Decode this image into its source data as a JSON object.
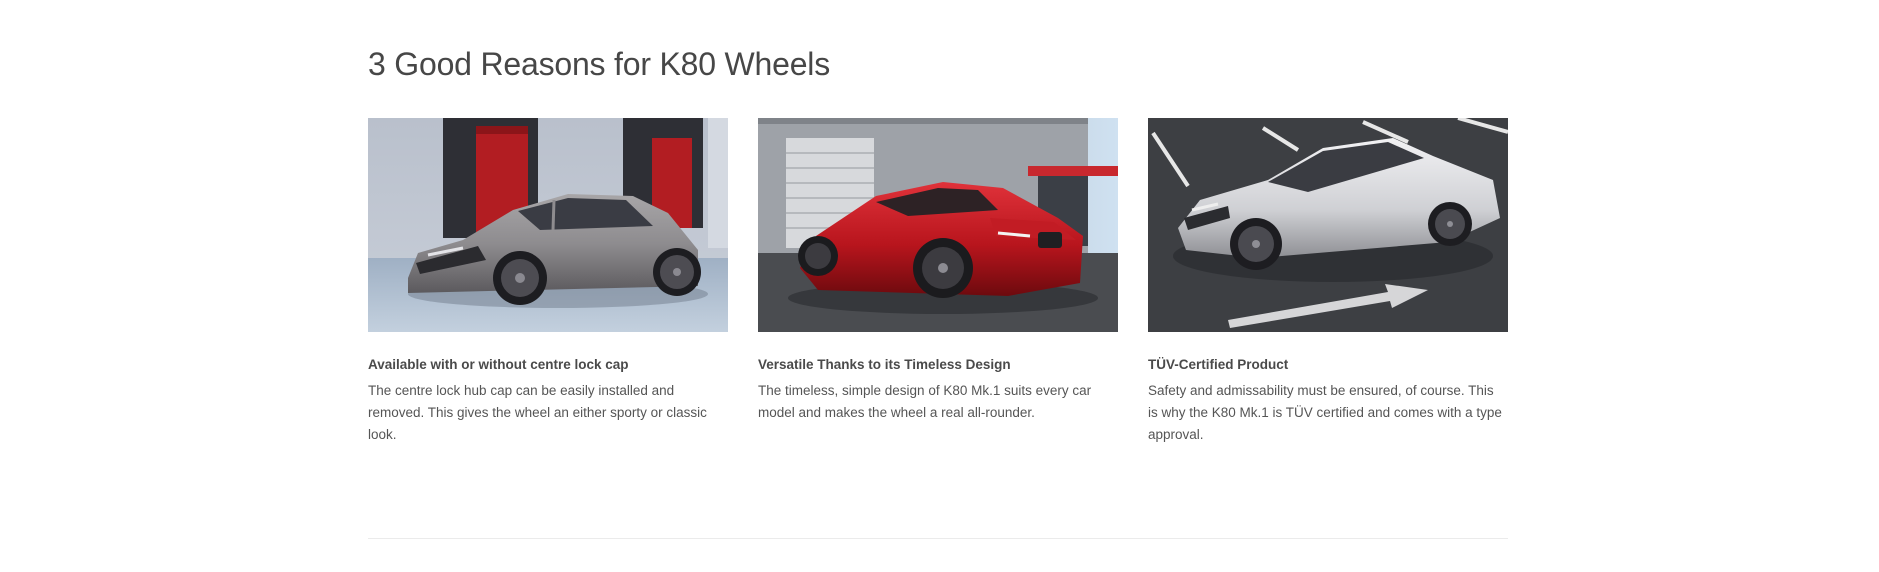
{
  "section": {
    "title": "3 Good Reasons for K80 Wheels"
  },
  "cards": [
    {
      "image": "grey-hatchback-car-photo",
      "title": "Available with or without centre lock cap",
      "text": "The centre lock hub cap can be easily installed and removed. This gives the wheel an either sporty or classic look."
    },
    {
      "image": "red-coupe-car-photo",
      "title": "Versatile Thanks to its Timeless Design",
      "text": "The timeless, simple design of K80 Mk.1 suits every car model and makes the wheel a real all-rounder."
    },
    {
      "image": "white-coupe-car-photo",
      "title": "TÜV-Certified Product",
      "text": "Safety and admissability must be ensured, of course. This is why the K80 Mk.1 is TÜV certified and comes with a type approval."
    }
  ],
  "colors": {
    "heading": "#474747",
    "body_text": "#555555",
    "divider": "#ebebeb"
  }
}
